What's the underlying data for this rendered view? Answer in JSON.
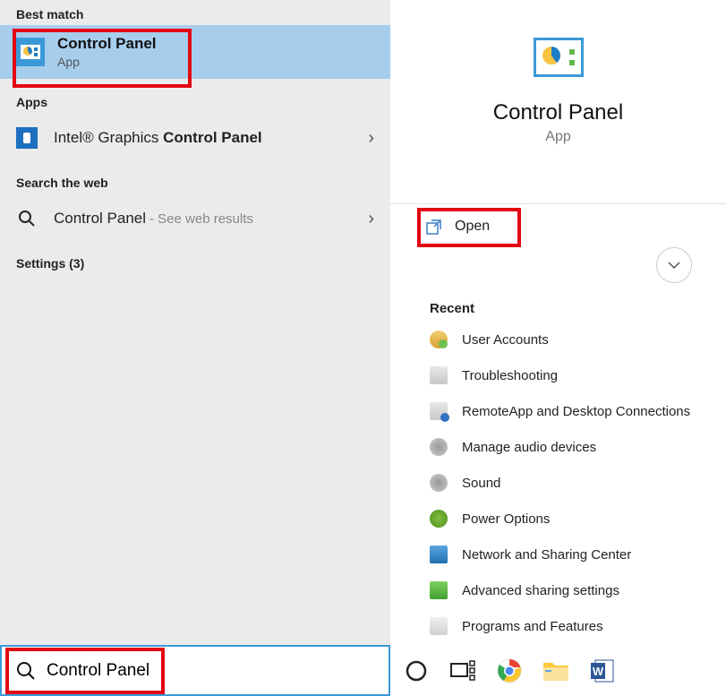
{
  "sections": {
    "best_match": "Best match",
    "apps": "Apps",
    "search_web": "Search the web",
    "settings": "Settings (3)"
  },
  "best_result": {
    "title": "Control Panel",
    "subtitle": "App"
  },
  "apps_item": {
    "prefix": "Intel® Graphics ",
    "bold": "Control Panel"
  },
  "web_item": {
    "query": "Control Panel",
    "hint": " - See web results"
  },
  "hero": {
    "title": "Control Panel",
    "subtitle": "App"
  },
  "open_label": "Open",
  "recent_header": "Recent",
  "recent": [
    "User Accounts",
    "Troubleshooting",
    "RemoteApp and Desktop Connections",
    "Manage audio devices",
    "Sound",
    "Power Options",
    "Network and Sharing Center",
    "Advanced sharing settings",
    "Programs and Features"
  ],
  "search_value": "Control Panel"
}
